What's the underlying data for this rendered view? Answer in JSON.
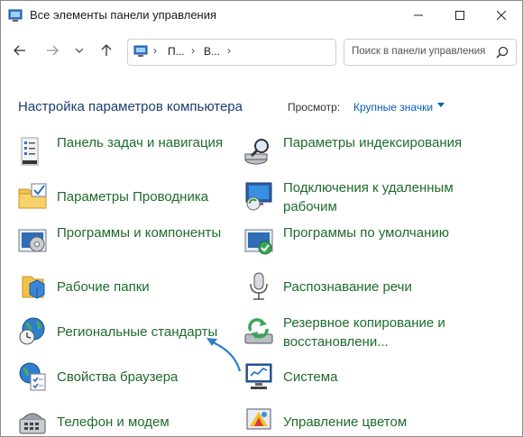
{
  "window": {
    "title": "Все элементы панели управления"
  },
  "address": {
    "crumbs": [
      "П...",
      "В..."
    ]
  },
  "search": {
    "placeholder": "Поиск в панели управления"
  },
  "header": {
    "title": "Настройка параметров компьютера",
    "view_label": "Просмотр:",
    "view_value": "Крупные значки"
  },
  "items": [
    {
      "label": "Панель задач и навигация",
      "icon": "taskbar-icon"
    },
    {
      "label": "Параметры индексирования",
      "icon": "indexing-icon"
    },
    {
      "label": "Параметры Проводника",
      "icon": "folder-options-icon"
    },
    {
      "label": "Подключения к удаленным рабочим",
      "icon": "remote-desktop-icon"
    },
    {
      "label": "Программы и компоненты",
      "icon": "programs-icon"
    },
    {
      "label": "Программы по умолчанию",
      "icon": "default-programs-icon"
    },
    {
      "label": "Рабочие папки",
      "icon": "work-folders-icon"
    },
    {
      "label": "Распознавание речи",
      "icon": "microphone-icon"
    },
    {
      "label": "Региональные стандарты",
      "icon": "region-globe-clock-icon"
    },
    {
      "label": "Резервное копирование и восстановлени...",
      "icon": "backup-icon"
    },
    {
      "label": "Свойства браузера",
      "icon": "internet-options-icon"
    },
    {
      "label": "Система",
      "icon": "system-monitor-icon"
    },
    {
      "label": "Телефон и модем",
      "icon": "phone-modem-icon"
    },
    {
      "label": "Управление цветом",
      "icon": "color-management-icon"
    }
  ]
}
